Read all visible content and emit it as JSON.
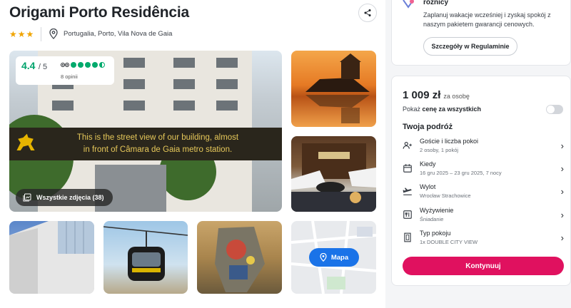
{
  "hotel": {
    "title": "Origami Porto Residência",
    "stars": "★★★",
    "location": "Portugalia, Porto, Vila Nova de Gaia"
  },
  "gallery": {
    "rating_score": "4.4",
    "rating_max": "/ 5",
    "opinions": "8 opinii",
    "banner_text_line1": "This is the street view of our building, almost",
    "banner_text_line2": "in front of Câmara de Gaia metro station.",
    "all_photos_label": "Wszystkie zdjęcia (38)",
    "map_label": "Mapa"
  },
  "promo": {
    "heading": "różnicy",
    "text": "Zaplanuj wakacje wcześniej i zyskaj spokój z naszym pakietem gwarancji cenowych.",
    "button_label": "Szczegóły w Regulaminie"
  },
  "booking": {
    "price": "1 009 zł",
    "price_per": "za osobę",
    "toggle_prefix": "Pokaż ",
    "toggle_bold": "cenę za wszystkich",
    "trip_title": "Twoja podróż",
    "rows": [
      {
        "label": "Goście i liczba pokoi",
        "value": "2 osoby, 1 pokój",
        "icon": "guests-icon"
      },
      {
        "label": "Kiedy",
        "value": "16 gru 2025 – 23 gru 2025, 7 nocy",
        "icon": "calendar-icon"
      },
      {
        "label": "Wylot",
        "value": "Wrocław Strachowice",
        "icon": "plane-icon"
      },
      {
        "label": "Wyżywienie",
        "value": "Śniadanie",
        "icon": "meal-icon"
      },
      {
        "label": "Typ pokoju",
        "value": "1x DOUBLE CITY VIEW",
        "icon": "room-icon"
      }
    ],
    "continue_label": "Kontynuuj"
  },
  "colors": {
    "accent": "#e0115f",
    "rating_green": "#00a36c",
    "map_button": "#1a73e8",
    "star": "#f0a400"
  }
}
